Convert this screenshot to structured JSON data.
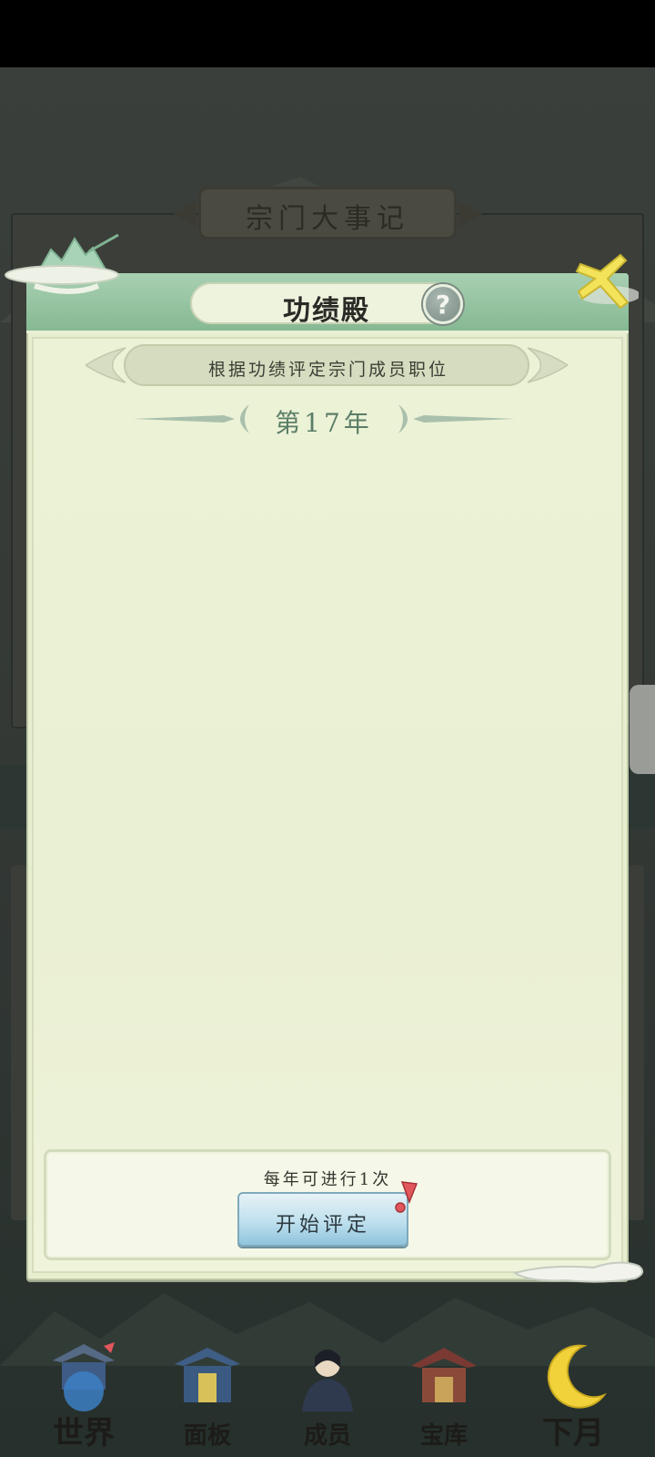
{
  "background": {
    "title": "宗门大事记"
  },
  "dialog": {
    "title": "功绩殿",
    "help_glyph": "?",
    "subtitle": "根据功绩评定宗门成员职位",
    "year_label": "第17年",
    "action": {
      "note": "每年可进行1次",
      "start_button_label": "开始评定"
    }
  },
  "bottom_nav": {
    "items": [
      {
        "label": "世界",
        "icon": "pagoda-globe-icon",
        "badge": true
      },
      {
        "label": "面板",
        "icon": "palace-panel-icon",
        "badge": false
      },
      {
        "label": "成员",
        "icon": "member-portrait-icon",
        "badge": false
      },
      {
        "label": "宝库",
        "icon": "treasury-icon",
        "badge": false
      },
      {
        "label": "下月",
        "icon": "crescent-moon-icon",
        "badge": false
      }
    ]
  },
  "colors": {
    "header_green": "#86b993",
    "panel_bg": "#e7eecf",
    "button_blue": "#bfe0ee",
    "alert_red": "#e0575c",
    "close_yellow": "#f3e35a"
  }
}
